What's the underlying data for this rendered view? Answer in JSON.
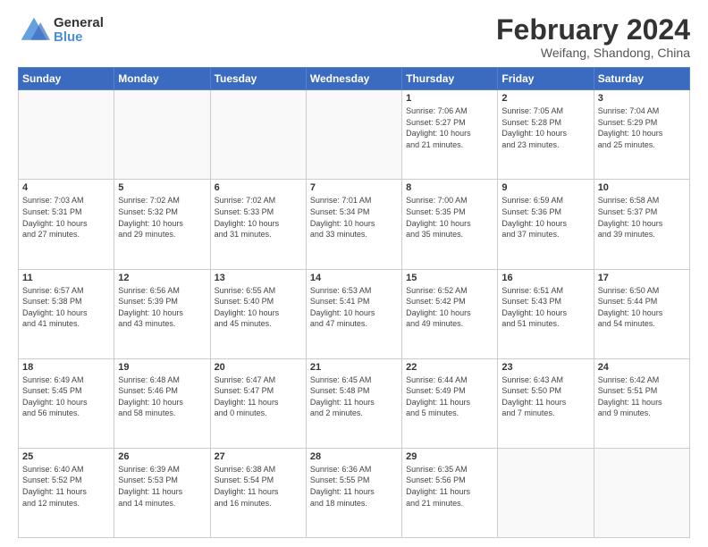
{
  "logo": {
    "general": "General",
    "blue": "Blue"
  },
  "title": {
    "month": "February 2024",
    "location": "Weifang, Shandong, China"
  },
  "days_header": [
    "Sunday",
    "Monday",
    "Tuesday",
    "Wednesday",
    "Thursday",
    "Friday",
    "Saturday"
  ],
  "weeks": [
    [
      {
        "day": "",
        "info": ""
      },
      {
        "day": "",
        "info": ""
      },
      {
        "day": "",
        "info": ""
      },
      {
        "day": "",
        "info": ""
      },
      {
        "day": "1",
        "info": "Sunrise: 7:06 AM\nSunset: 5:27 PM\nDaylight: 10 hours\nand 21 minutes."
      },
      {
        "day": "2",
        "info": "Sunrise: 7:05 AM\nSunset: 5:28 PM\nDaylight: 10 hours\nand 23 minutes."
      },
      {
        "day": "3",
        "info": "Sunrise: 7:04 AM\nSunset: 5:29 PM\nDaylight: 10 hours\nand 25 minutes."
      }
    ],
    [
      {
        "day": "4",
        "info": "Sunrise: 7:03 AM\nSunset: 5:31 PM\nDaylight: 10 hours\nand 27 minutes."
      },
      {
        "day": "5",
        "info": "Sunrise: 7:02 AM\nSunset: 5:32 PM\nDaylight: 10 hours\nand 29 minutes."
      },
      {
        "day": "6",
        "info": "Sunrise: 7:02 AM\nSunset: 5:33 PM\nDaylight: 10 hours\nand 31 minutes."
      },
      {
        "day": "7",
        "info": "Sunrise: 7:01 AM\nSunset: 5:34 PM\nDaylight: 10 hours\nand 33 minutes."
      },
      {
        "day": "8",
        "info": "Sunrise: 7:00 AM\nSunset: 5:35 PM\nDaylight: 10 hours\nand 35 minutes."
      },
      {
        "day": "9",
        "info": "Sunrise: 6:59 AM\nSunset: 5:36 PM\nDaylight: 10 hours\nand 37 minutes."
      },
      {
        "day": "10",
        "info": "Sunrise: 6:58 AM\nSunset: 5:37 PM\nDaylight: 10 hours\nand 39 minutes."
      }
    ],
    [
      {
        "day": "11",
        "info": "Sunrise: 6:57 AM\nSunset: 5:38 PM\nDaylight: 10 hours\nand 41 minutes."
      },
      {
        "day": "12",
        "info": "Sunrise: 6:56 AM\nSunset: 5:39 PM\nDaylight: 10 hours\nand 43 minutes."
      },
      {
        "day": "13",
        "info": "Sunrise: 6:55 AM\nSunset: 5:40 PM\nDaylight: 10 hours\nand 45 minutes."
      },
      {
        "day": "14",
        "info": "Sunrise: 6:53 AM\nSunset: 5:41 PM\nDaylight: 10 hours\nand 47 minutes."
      },
      {
        "day": "15",
        "info": "Sunrise: 6:52 AM\nSunset: 5:42 PM\nDaylight: 10 hours\nand 49 minutes."
      },
      {
        "day": "16",
        "info": "Sunrise: 6:51 AM\nSunset: 5:43 PM\nDaylight: 10 hours\nand 51 minutes."
      },
      {
        "day": "17",
        "info": "Sunrise: 6:50 AM\nSunset: 5:44 PM\nDaylight: 10 hours\nand 54 minutes."
      }
    ],
    [
      {
        "day": "18",
        "info": "Sunrise: 6:49 AM\nSunset: 5:45 PM\nDaylight: 10 hours\nand 56 minutes."
      },
      {
        "day": "19",
        "info": "Sunrise: 6:48 AM\nSunset: 5:46 PM\nDaylight: 10 hours\nand 58 minutes."
      },
      {
        "day": "20",
        "info": "Sunrise: 6:47 AM\nSunset: 5:47 PM\nDaylight: 11 hours\nand 0 minutes."
      },
      {
        "day": "21",
        "info": "Sunrise: 6:45 AM\nSunset: 5:48 PM\nDaylight: 11 hours\nand 2 minutes."
      },
      {
        "day": "22",
        "info": "Sunrise: 6:44 AM\nSunset: 5:49 PM\nDaylight: 11 hours\nand 5 minutes."
      },
      {
        "day": "23",
        "info": "Sunrise: 6:43 AM\nSunset: 5:50 PM\nDaylight: 11 hours\nand 7 minutes."
      },
      {
        "day": "24",
        "info": "Sunrise: 6:42 AM\nSunset: 5:51 PM\nDaylight: 11 hours\nand 9 minutes."
      }
    ],
    [
      {
        "day": "25",
        "info": "Sunrise: 6:40 AM\nSunset: 5:52 PM\nDaylight: 11 hours\nand 12 minutes."
      },
      {
        "day": "26",
        "info": "Sunrise: 6:39 AM\nSunset: 5:53 PM\nDaylight: 11 hours\nand 14 minutes."
      },
      {
        "day": "27",
        "info": "Sunrise: 6:38 AM\nSunset: 5:54 PM\nDaylight: 11 hours\nand 16 minutes."
      },
      {
        "day": "28",
        "info": "Sunrise: 6:36 AM\nSunset: 5:55 PM\nDaylight: 11 hours\nand 18 minutes."
      },
      {
        "day": "29",
        "info": "Sunrise: 6:35 AM\nSunset: 5:56 PM\nDaylight: 11 hours\nand 21 minutes."
      },
      {
        "day": "",
        "info": ""
      },
      {
        "day": "",
        "info": ""
      }
    ]
  ]
}
